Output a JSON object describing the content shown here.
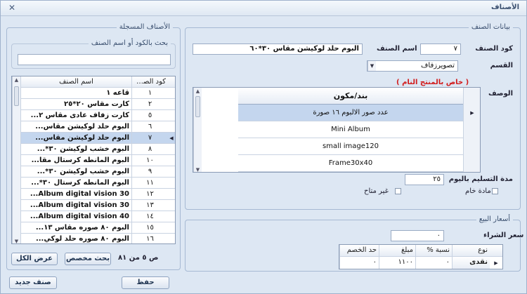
{
  "window": {
    "title": "الأصناف",
    "close_glyph": "✕"
  },
  "left_panel": {
    "legend": "الأصناف المسجلة",
    "search": {
      "legend": "بحث بالكود أو اسم الصنف",
      "value": ""
    },
    "table": {
      "columns": [
        "كود الصنف",
        "اسم الصنف"
      ],
      "rows": [
        {
          "code": "١",
          "name": "قاعه ١"
        },
        {
          "code": "٢",
          "name": "كارت مقاس ٢٠*٢٥"
        },
        {
          "code": "٥",
          "name": "كارت زفاف عادى مقاس ٢..."
        },
        {
          "code": "٦",
          "name": "البوم حلد لوكيشن مقاس..."
        },
        {
          "code": "٧",
          "name": "البوم حلد لوكيشن مقاس..."
        },
        {
          "code": "٨",
          "name": "البوم خشب لوكيشن ٣٠*..."
        },
        {
          "code": "١٠",
          "name": "البوم المانطه كرستال مقا..."
        },
        {
          "code": "٩",
          "name": "البوم خشب لوكيشن ٣٠*..."
        },
        {
          "code": "١١",
          "name": "البوم المانطه كرستال ٣٠*..."
        },
        {
          "code": "١٢",
          "name": "Album digital vision 30..."
        },
        {
          "code": "١٣",
          "name": "Album digital vision 30..."
        },
        {
          "code": "١٤",
          "name": "Album digital vision 40..."
        },
        {
          "code": "١٥",
          "name": "البوم ٨٠ صوره مقاس ١٣..."
        },
        {
          "code": "١٦",
          "name": "البوم ٨٠ صوره حلد لوكي..."
        }
      ],
      "selected_index": 4
    },
    "counter": "ص ٥ من ٨١",
    "btn_search": "بحث مخصص",
    "btn_show_all": "عرض الكل",
    "btn_new": "صنف جديد"
  },
  "right_panel": {
    "legend": "بيانات الصنف",
    "code_label": "كود الصنف",
    "code_value": "٧",
    "name_label": "اسم الصنف",
    "name_value": "البوم حلد لوكيشن مقاس ٣٠*٦٠",
    "category_label": "القسم",
    "category_value": "تصويرزفاف",
    "description_label": "الوصف",
    "final_product_note": "( خاص بالمنتج النام )",
    "components": {
      "header": "بند/مكون",
      "rows": [
        "عدد صور الالبوم ١٦ صورة",
        "Mini Album",
        "small image120",
        "Frame30x40"
      ],
      "selected_index": 0
    },
    "delivery_label": "مدة التسليم باليوم",
    "delivery_value": "٢٥",
    "raw_material_label": "مادة خام",
    "unavailable_label": "غير متاح"
  },
  "prices_panel": {
    "legend": "أسعار البيع",
    "purchase_label": "سعر الشراء",
    "purchase_value": "٠",
    "table": {
      "columns": [
        "نوع",
        "نسبة %",
        "مبلغ",
        "حد الخصم"
      ],
      "row": {
        "type": "نقدى",
        "percent": "٠",
        "amount": "١١٠٠",
        "discount": "٠"
      }
    }
  },
  "footer": {
    "btn_save": "حفظ"
  }
}
